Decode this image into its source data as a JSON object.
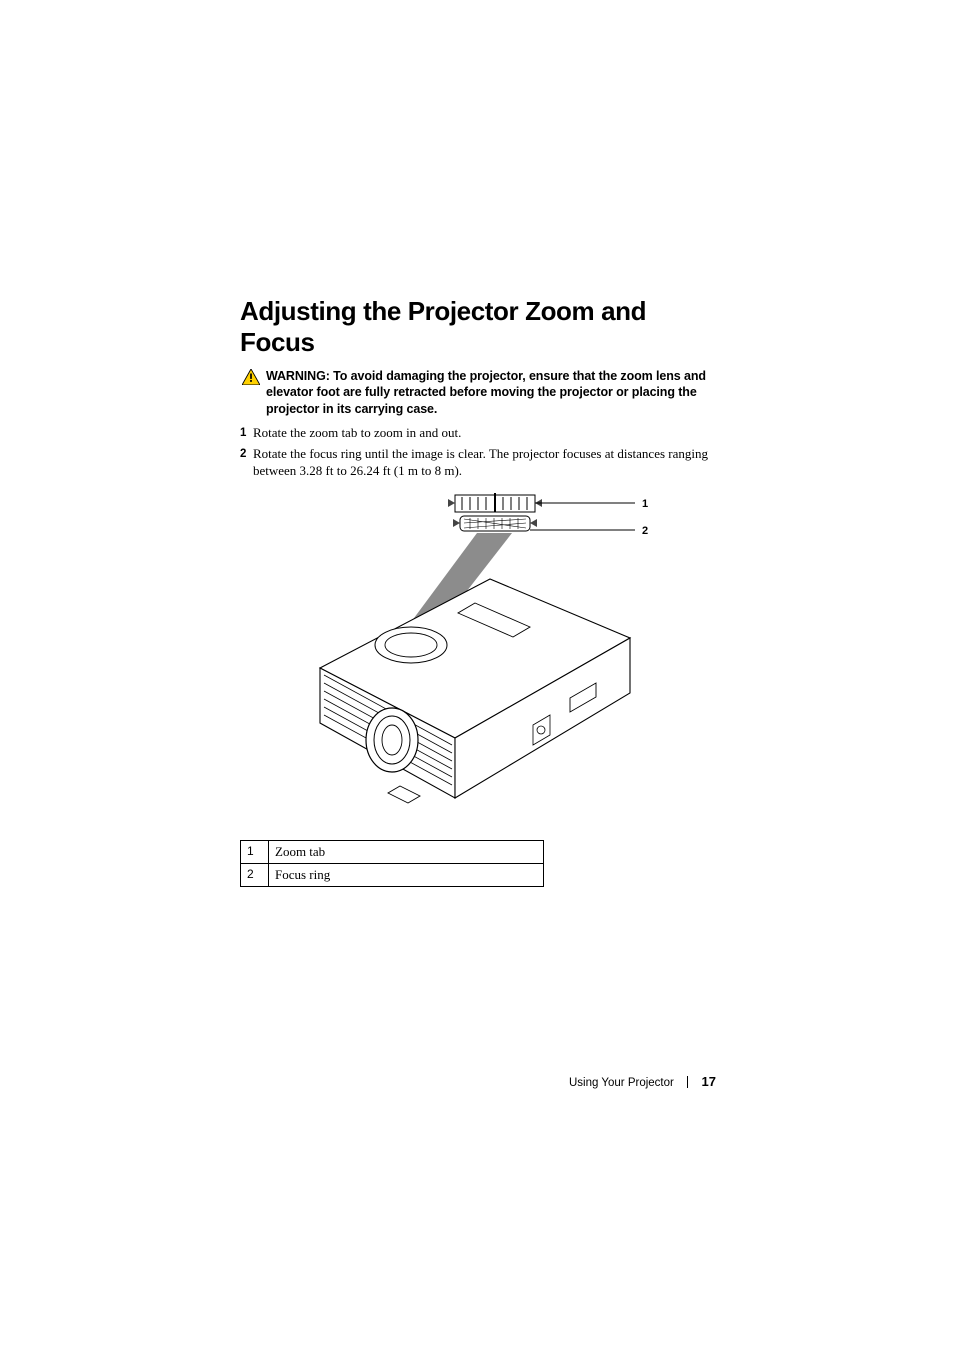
{
  "heading": "Adjusting the Projector Zoom and Focus",
  "warning": {
    "prefix": "WARNING:",
    "body": " To avoid damaging the projector, ensure that the zoom lens and elevator foot are fully retracted before moving the projector or placing the projector in its carrying case."
  },
  "steps": [
    {
      "num": "1",
      "text": "Rotate the zoom tab to zoom in and out."
    },
    {
      "num": "2",
      "text": "Rotate the focus ring until the image is clear. The projector focuses at distances ranging between 3.28 ft to 26.24 ft (1 m to 8 m)."
    }
  ],
  "callouts": {
    "c1": "1",
    "c2": "2"
  },
  "legend": [
    {
      "num": "1",
      "label": "Zoom tab"
    },
    {
      "num": "2",
      "label": "Focus ring"
    }
  ],
  "footer": {
    "section": "Using Your Projector",
    "page": "17"
  }
}
